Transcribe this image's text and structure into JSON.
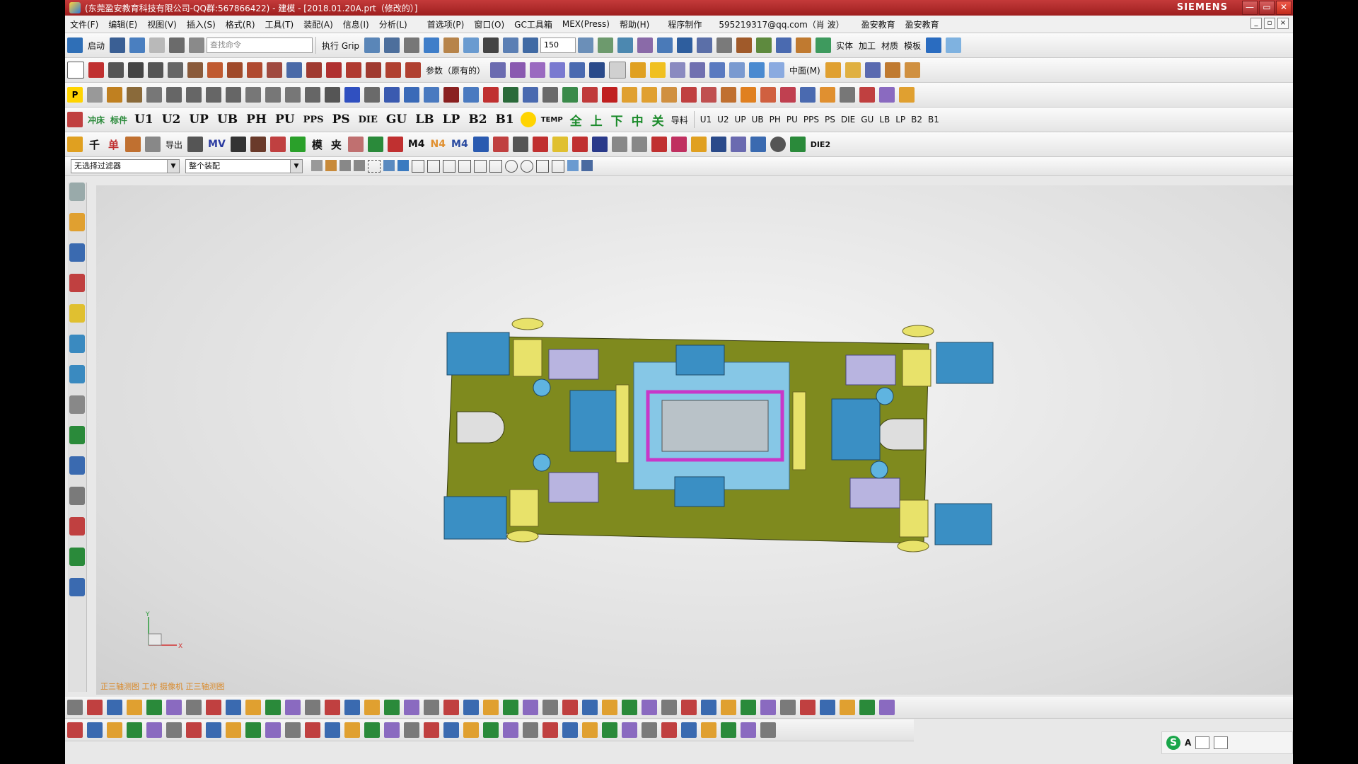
{
  "window": {
    "title": "(东莞盈安教育科技有限公司-QQ群:567866422) - 建模 - [2018.01.20A.prt（修改的）]",
    "brand": "SIEMENS",
    "minimize": "—",
    "restore": "▭",
    "close": "✕"
  },
  "menu": [
    {
      "label": "文件(F)"
    },
    {
      "label": "编辑(E)"
    },
    {
      "label": "视图(V)"
    },
    {
      "label": "插入(S)"
    },
    {
      "label": "格式(R)"
    },
    {
      "label": "工具(T)"
    },
    {
      "label": "装配(A)"
    },
    {
      "label": "信息(I)"
    },
    {
      "label": "分析(L)"
    },
    {
      "label": "首选项(P)"
    },
    {
      "label": "窗口(O)"
    },
    {
      "label": "GC工具箱"
    },
    {
      "label": "MEX(Press)"
    },
    {
      "label": "帮助(H)"
    },
    {
      "label": "程序制作"
    },
    {
      "label": "595219317@qq.com（肖 波）"
    },
    {
      "label": "盈安教育"
    },
    {
      "label": "盈安教育"
    }
  ],
  "toolbar1": {
    "start_label": "启动",
    "search_placeholder": "查找命令",
    "grip_label": "执行 Grip",
    "zoom_value": "150",
    "right_labels": [
      "实体",
      "加工",
      "材质",
      "模板"
    ]
  },
  "toolbar2": {
    "param_label": "参数（原有的）",
    "middle_label": "中面(M)"
  },
  "toolbar4": {
    "labels": [
      "冲床",
      "标件",
      "U1",
      "U2",
      "UP",
      "UB",
      "PH",
      "PU",
      "PPS",
      "PS",
      "DIE",
      "GU",
      "LB",
      "LP",
      "B2",
      "B1"
    ],
    "temp": "TEMP",
    "chars": [
      "全",
      "上",
      "下",
      "中",
      "关"
    ],
    "guide": "导料",
    "right_labels": [
      "U1",
      "U2",
      "UP",
      "UB",
      "PH",
      "PU",
      "PPS",
      "PS",
      "DIE",
      "GU",
      "LB",
      "LP",
      "B2",
      "B1"
    ]
  },
  "toolbar5": {
    "chars": [
      "千",
      "单"
    ],
    "export": "导出",
    "mv": "MV",
    "mold": "模",
    "clip": "夹",
    "m4": "M4",
    "n4": "N4",
    "m4b": "M4",
    "die2": "DIE2"
  },
  "filterbar": {
    "filter": "无选择过滤器",
    "assembly": "整个装配"
  },
  "statusbar": {
    "text": "正三轴测图 工作 摄像机 正三轴测图"
  },
  "triad": {
    "x": "X",
    "y": "Y"
  },
  "taskbar": {
    "ime": "S",
    "lang": "A"
  },
  "colors": {
    "plate": "#7f8a1e",
    "block": "#3a8fc4",
    "insert": "#86c7e6",
    "pin": "#e8e26a",
    "magenta": "#c837c8",
    "accent": "#c43a3a"
  }
}
